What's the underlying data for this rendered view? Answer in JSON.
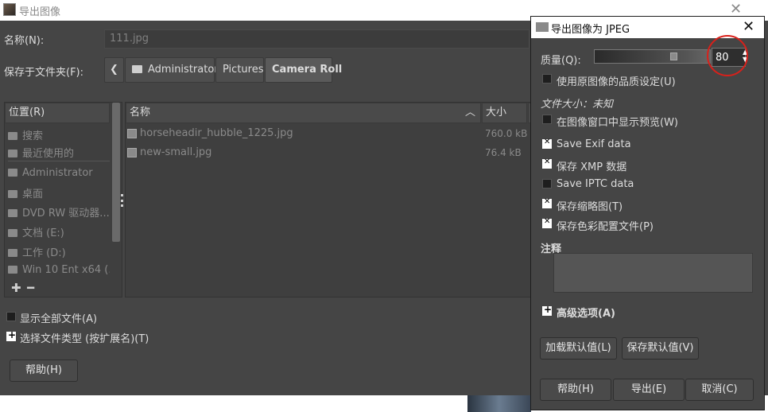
{
  "main_dialog": {
    "title": "导出图像",
    "name_label": "名称(N):",
    "name_value": "111.jpg",
    "folder_label": "保存于文件夹(F):",
    "breadcrumbs": [
      "Administrator",
      "Pictures",
      "Camera Roll"
    ],
    "places": {
      "header": "位置(R)",
      "items": [
        "搜索",
        "最近使用的",
        "Administrator",
        "桌面",
        "DVD RW 驱动器...",
        "文档 (E:)",
        "工作 (D:)",
        "Win 10 Ent x64 (..."
      ]
    },
    "files": {
      "name_header": "名称",
      "size_header": "大小",
      "rows": [
        {
          "name": "horseheadir_hubble_1225.jpg",
          "size": "760.0 kB"
        },
        {
          "name": "new-small.jpg",
          "size": "76.4 kB"
        }
      ]
    },
    "show_all_files_label": "显示全部文件(A)",
    "select_file_type_label": "选择文件类型 (按扩展名)(T)",
    "help_button": "帮助(H)"
  },
  "jpeg_dialog": {
    "title": "导出图像为 JPEG",
    "quality_label": "质量(Q):",
    "quality_value": "80",
    "quality_level": 0.8,
    "use_original_quality_label": "使用原图像的品质设定(U)",
    "file_size_label": "文件大小：未知",
    "show_preview_label": "在图像窗口中显示预览(W)",
    "options": [
      {
        "label": "Save Exif data",
        "checked": true
      },
      {
        "label": "保存 XMP 数据",
        "checked": true
      },
      {
        "label": "Save IPTC data",
        "checked": false
      },
      {
        "label": "保存缩略图(T)",
        "checked": true
      },
      {
        "label": "保存色彩配置文件(P)",
        "checked": true
      }
    ],
    "comment_label": "注释",
    "advanced_label": "高级选项(A)",
    "load_defaults_button": "加载默认值(L)",
    "save_defaults_button": "保存默认值(V)",
    "help_button": "帮助(H)",
    "export_button": "导出(E)",
    "cancel_button": "取消(C)"
  },
  "colors": {
    "highlight_circle": "#d9201a"
  }
}
